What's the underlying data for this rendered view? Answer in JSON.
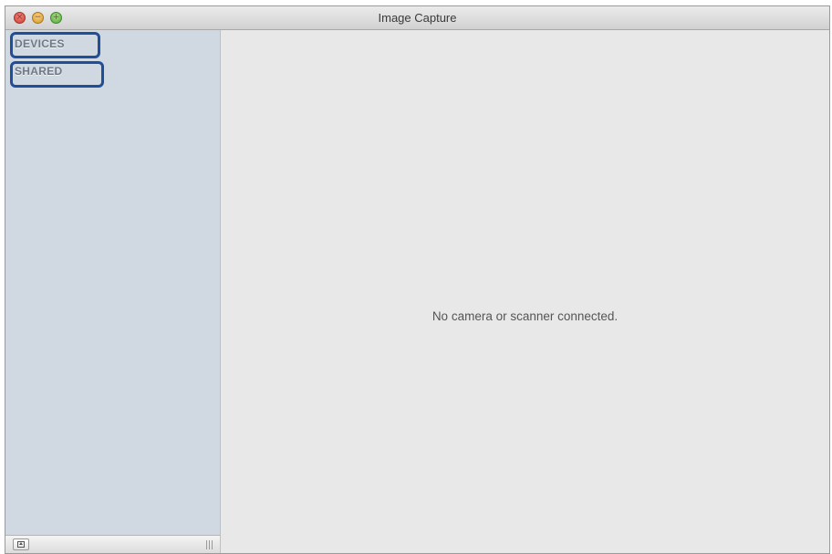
{
  "window": {
    "title": "Image Capture"
  },
  "sidebar": {
    "sections": [
      {
        "label": "DEVICES"
      },
      {
        "label": "SHARED"
      }
    ]
  },
  "main": {
    "empty_message": "No camera or scanner connected."
  },
  "colors": {
    "sidebar_background": "#d0d8e1",
    "content_background": "#e8e8e8",
    "highlight_outline": "#1f4f98"
  }
}
